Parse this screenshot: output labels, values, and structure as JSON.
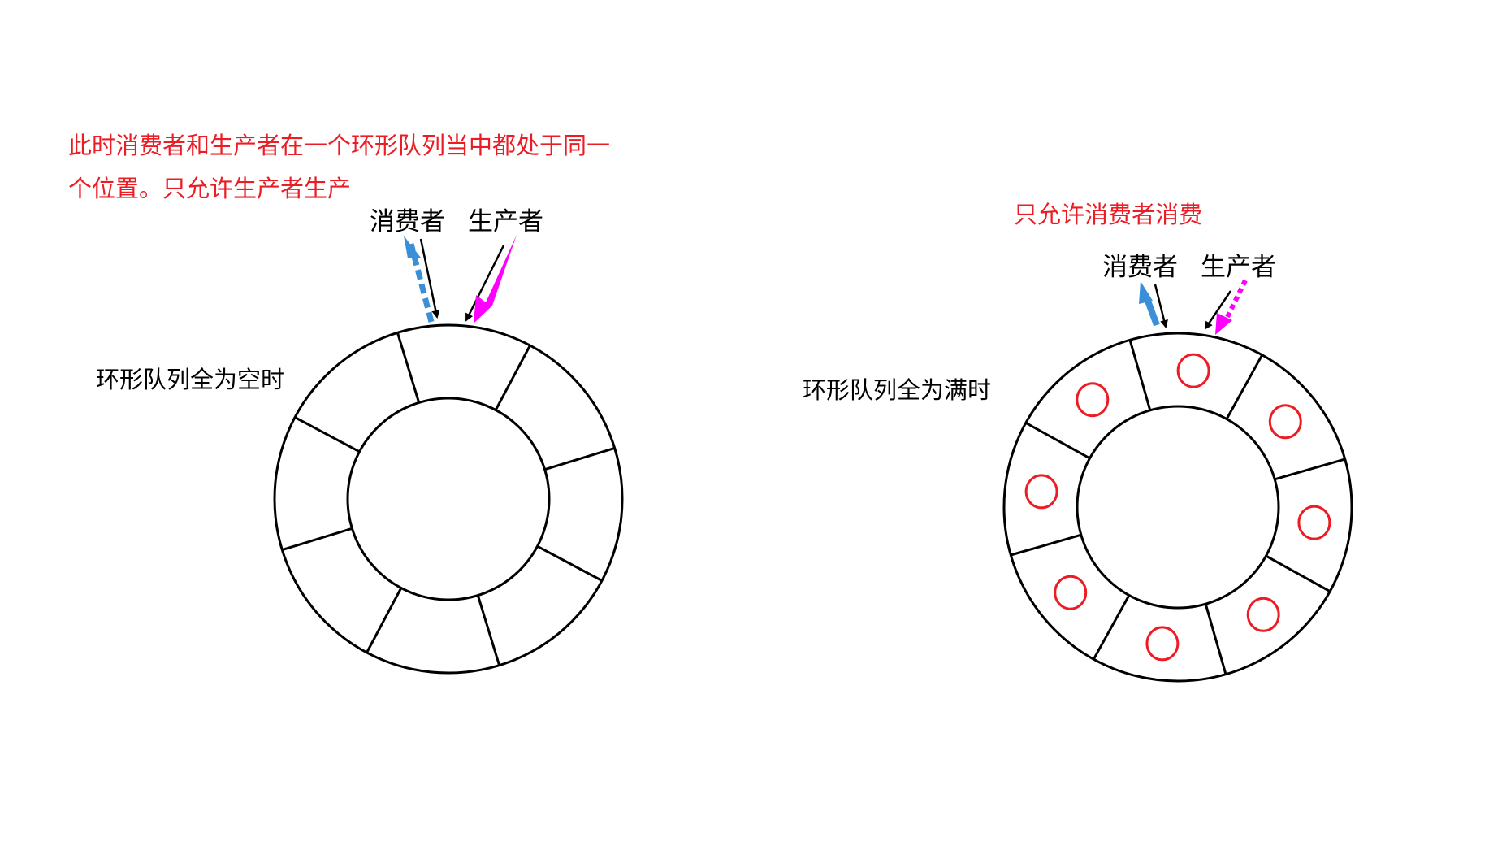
{
  "colors": {
    "background": "#ffffff",
    "stroke": "#000000",
    "note_text": "#ec1c24",
    "consumer_arrow": "#3a8fd8",
    "producer_arrow": "#ff00ff",
    "item_circle": "#ec1c24"
  },
  "left_panel": {
    "note_line1": "此时消费者和生产者在一个环形队列当中都处于同一",
    "note_line2": "个位置。只允许生产者生产",
    "consumer_label": "消费者",
    "producer_label": "生产者",
    "state_label": "环形队列全为空时",
    "slot_count": 8,
    "filled_slots": 0
  },
  "right_panel": {
    "note": "只允许消费者消费",
    "consumer_label": "消费者",
    "producer_label": "生产者",
    "state_label": "环形队列全为满时",
    "slot_count": 8,
    "filled_slots": 8
  }
}
